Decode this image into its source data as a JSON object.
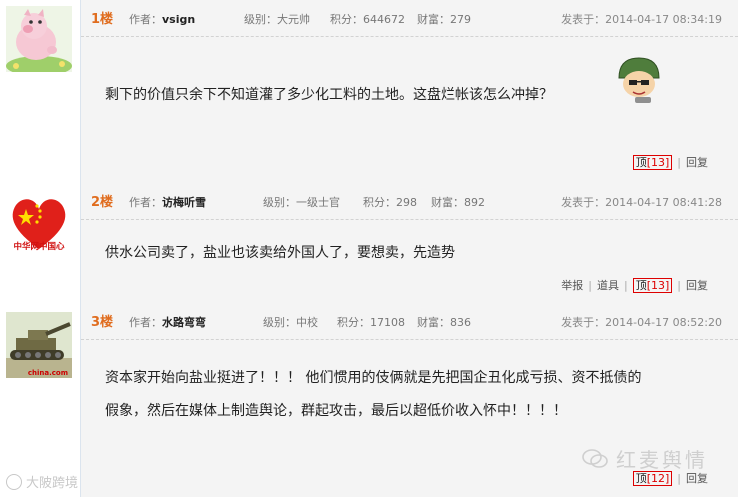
{
  "posts": [
    {
      "floor": "1楼",
      "author_label": "作者：",
      "author": "vsign",
      "level_label": "级别：",
      "level": "大元帅",
      "points_label": "积分：",
      "points": "644672",
      "wealth_label": "财富：",
      "wealth": "279",
      "date_label": "发表于：",
      "date": "2014-04-17 08:34:19",
      "content": "剩下的价值只余下不知道灌了多少化工料的土地。这盘烂帐该怎么冲掉？",
      "up_label": "顶",
      "up_count": "[13]",
      "reply": "回复"
    },
    {
      "floor": "2楼",
      "author_label": "作者：",
      "author": "访梅听雪",
      "level_label": "级别：",
      "level": "一级士官",
      "points_label": "积分：",
      "points": "298",
      "wealth_label": "财富：",
      "wealth": "892",
      "date_label": "发表于：",
      "date": "2014-04-17 08:41:28",
      "avatar_caption": "中华网中国心",
      "content": "供水公司卖了，盐业也该卖给外国人了，要想卖，先造势",
      "report": "举报",
      "tool": "道具",
      "up_label": "顶",
      "up_count": "[13]",
      "reply": "回复"
    },
    {
      "floor": "3楼",
      "author_label": "作者：",
      "author": "水路弯弯",
      "level_label": "级别：",
      "level": "中校",
      "points_label": "积分：",
      "points": "17108",
      "wealth_label": "财富：",
      "wealth": "836",
      "date_label": "发表于：",
      "date": "2014-04-17 08:52:20",
      "avatar_caption": "china.com",
      "content_line1": "资本家开始向盐业挺进了！！！ 他们惯用的伎俩就是先把国企丑化成亏损、资不抵债的",
      "content_line2": "假象，然后在媒体上制造舆论，群起攻击，最后以超低价收入怀中！！！！",
      "up_label": "顶",
      "up_count": "[12]",
      "reply": "回复"
    }
  ],
  "watermark": "红麦舆情",
  "watermark2": "大陂跨境"
}
